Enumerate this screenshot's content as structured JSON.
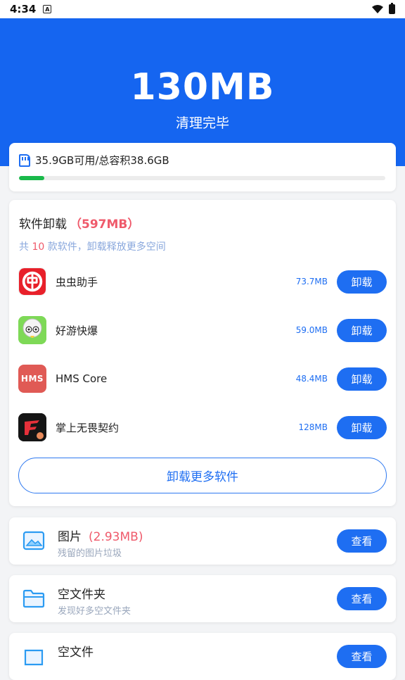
{
  "status_bar": {
    "time": "4:34",
    "notification_icon": "A"
  },
  "hero": {
    "size": "130MB",
    "label": "清理完毕",
    "bg_color": "#1565f0"
  },
  "storage": {
    "text": "35.9GB可用/总容积38.6GB",
    "used_fraction": 0.07,
    "bar_color": "#19b94a"
  },
  "apps": {
    "title": "软件卸载",
    "title_amount": "（597MB）",
    "sub_prefix": "共 ",
    "sub_count": "10",
    "sub_suffix": " 款软件，卸载释放更多空间",
    "items": [
      {
        "name": "虫虫助手",
        "size": "73.7MB",
        "button": "卸载",
        "icon": "chongchong-icon"
      },
      {
        "name": "好游快爆",
        "size": "59.0MB",
        "button": "卸载",
        "icon": "haoyou-icon"
      },
      {
        "name": "HMS Core",
        "size": "48.4MB",
        "button": "卸载",
        "icon": "hms-icon",
        "icon_text": "HMS"
      },
      {
        "name": "掌上无畏契约",
        "size": "128MB",
        "button": "卸载",
        "icon": "valorant-icon"
      }
    ],
    "more_button": "卸载更多软件"
  },
  "sections": [
    {
      "name": "图片",
      "amount": "(2.93MB)",
      "desc": "残留的图片垃圾",
      "button": "查看",
      "icon": "image-icon"
    },
    {
      "name": "空文件夹",
      "amount": "",
      "desc": "发现好多空文件夹",
      "button": "查看",
      "icon": "folder-icon"
    },
    {
      "name": "空文件",
      "amount": "",
      "desc": "",
      "button": "查看",
      "icon": "file-icon"
    }
  ],
  "colors": {
    "accent": "#1e6ef2",
    "highlight": "#ef5a6b"
  }
}
